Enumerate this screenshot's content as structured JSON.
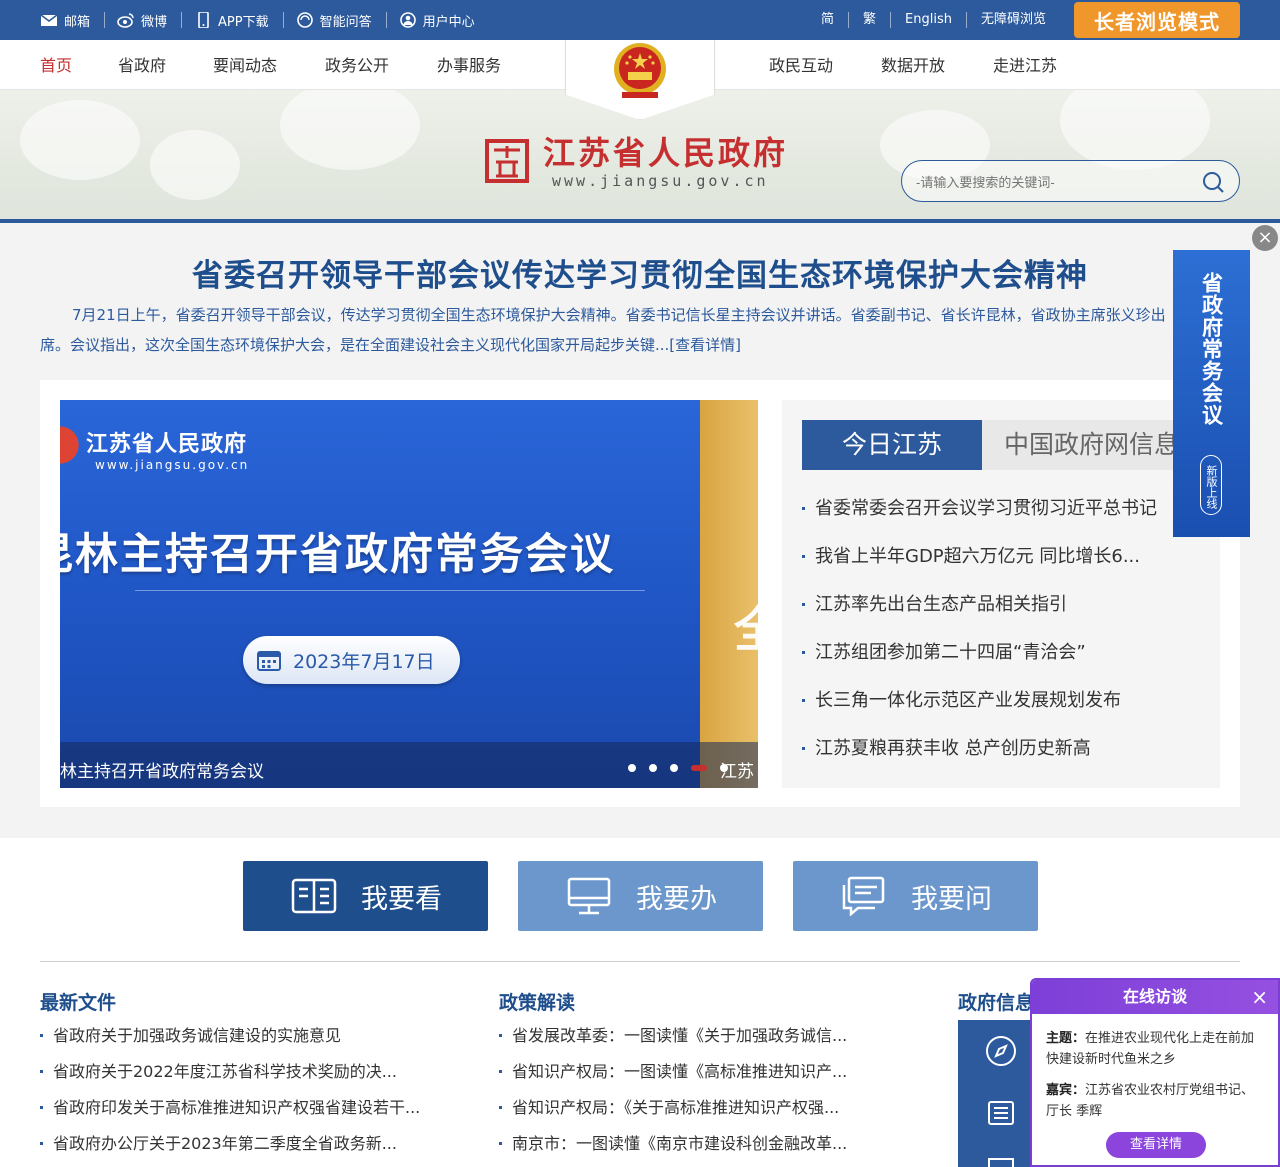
{
  "topbar": {
    "left": [
      {
        "icon": "mail-icon",
        "label": "邮箱"
      },
      {
        "icon": "weibo-icon",
        "label": "微博"
      },
      {
        "icon": "phone-icon",
        "label": "APP下载"
      },
      {
        "icon": "chat-icon",
        "label": "智能问答"
      },
      {
        "icon": "user-icon",
        "label": "用户中心"
      }
    ],
    "langs": [
      "简",
      "繁",
      "English",
      "无障碍浏览"
    ],
    "elder_mode": "长者浏览模式"
  },
  "nav": {
    "left": [
      "首页",
      "省政府",
      "要闻动态",
      "政务公开",
      "办事服务"
    ],
    "right": [
      "政民互动",
      "数据开放",
      "走进江苏"
    ]
  },
  "banner": {
    "title": "江苏省人民政府",
    "url": "www.jiangsu.gov.cn",
    "search_placeholder": "-请输入要搜索的关键词-"
  },
  "headline": {
    "title": "省委召开领导干部会议传达学习贯彻全国生态环境保护大会精神",
    "summary": "7月21日上午，省委召开领导干部会议，传达学习贯彻全国生态环境保护大会精神。省委书记信长星主持会议并讲话。省委副书记、省长许昆林，省政协主席张义珍出席。会议指出，这次全国生态环境保护大会，是在全面建设社会主义现代化国家开局起步关键...[查看详情]"
  },
  "float_banner": {
    "title": "省政府常务会议",
    "badge": "新版上线",
    "close": "×"
  },
  "slide": {
    "org": "江苏省人民政府",
    "url": "www.jiangsu.gov.cn",
    "title": "许昆林主持召开省政府常务会议",
    "date": "2023年7月17日",
    "caption": "许昆林主持召开省政府常务会议",
    "next_caption": "江苏",
    "next_char": "全",
    "dots": 5,
    "active_dot": 4
  },
  "news": {
    "tabs": [
      "今日江苏",
      "中国政府网信息"
    ],
    "items": [
      "省委常委会召开会议学习贯彻习近平总书记",
      "我省上半年GDP超六万亿元 同比增长6...",
      "江苏率先出台生态产品相关指引",
      "江苏组团参加第二十四届“青洽会”",
      "长三角一体化示范区产业发展规划发布",
      "江苏夏粮再获丰收 总产创历史新高"
    ]
  },
  "service_buttons": [
    "我要看",
    "我要办",
    "我要问"
  ],
  "columns": {
    "latest_docs": {
      "title": "最新文件",
      "items": [
        "省政府关于加强政务诚信建设的实施意见",
        "省政府关于2022年度江苏省科学技术奖励的决...",
        "省政府印发关于高标准推进知识产权强省建设若干...",
        "省政府办公厅关于2023年第二季度全省政务新..."
      ]
    },
    "policy": {
      "title": "政策解读",
      "items": [
        "省发展改革委：一图读懂《关于加强政务诚信...",
        "省知识产权局：一图读懂《高标准推进知识产...",
        "省知识产权局：《关于高标准推进知识产权强...",
        "南京市：一图读懂《南京市建设科创金融改革..."
      ]
    },
    "gov_info": {
      "title": "政府信息公开"
    }
  },
  "interview": {
    "header": "在线访谈",
    "close": "×",
    "topic_label": "主题：",
    "topic": "在推进农业现代化上走在前加快建设新时代鱼米之乡",
    "guest_label": "嘉宾：",
    "guest": "江苏省农业农村厅党组书记、厅长 季辉",
    "button": "查看详情"
  },
  "colors": {
    "primary": "#2d5a9c",
    "brand_red": "#c62f2f",
    "elder_orange": "#f0972c",
    "interview_purple": "#7d3fd8"
  }
}
